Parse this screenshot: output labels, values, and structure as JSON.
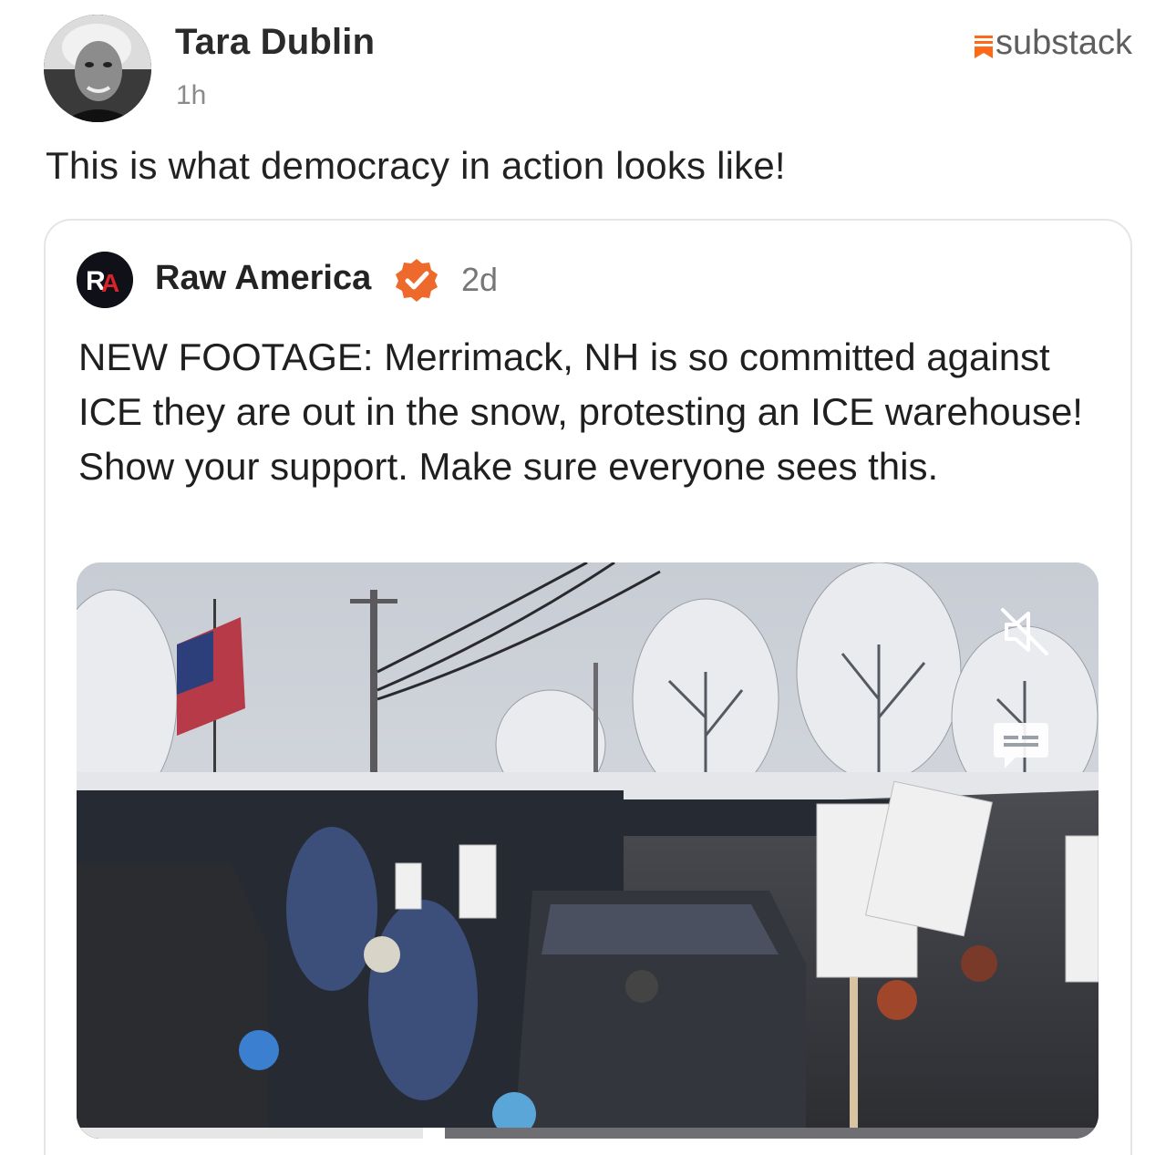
{
  "post": {
    "author": "Tara Dublin",
    "time": "1h",
    "source": "substack",
    "text": "This is what democracy in action looks like!"
  },
  "quoted": {
    "author": "Raw America",
    "avatar_initials": "RA",
    "verified": true,
    "time": "2d",
    "text": "NEW FOOTAGE: Merrimack, NH is so committed against ICE they are out in the snow, protesting an ICE warehouse! Show your support. Make sure everyone sees this.",
    "video": {
      "muted": true,
      "progress": 0.35,
      "icons": [
        "muted-speaker-icon",
        "captions-icon"
      ]
    }
  },
  "colors": {
    "substack": "#ff6719",
    "verified": "#ee6a2c",
    "raw_america_red": "#d8232a"
  }
}
